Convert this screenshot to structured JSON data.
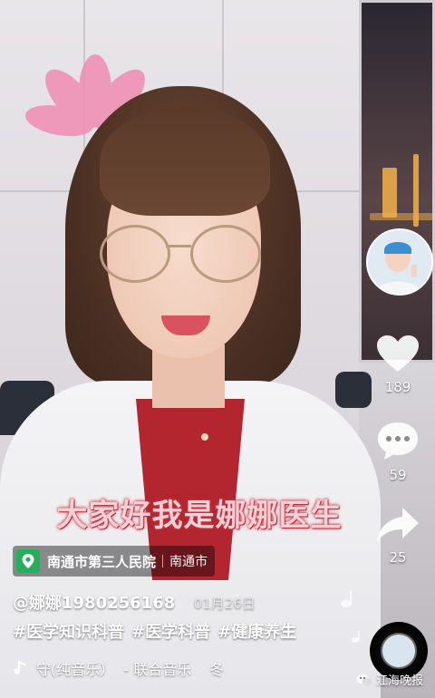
{
  "video": {
    "caption": "大家好我是娜娜医生"
  },
  "location": {
    "icon": "map-pin-icon",
    "name": "南通市第三人民院",
    "city": "南通市",
    "accent": "#23b05a"
  },
  "post": {
    "author": "@娜娜1980256168",
    "dot": "·",
    "date": "01月26日",
    "hashtags": [
      "#医学知识科普",
      "#医学科普",
      "#健康养生"
    ]
  },
  "music": {
    "icon": "music-note-icon",
    "title": "守(纯音乐）  - 联合音乐",
    "trailing": "冬"
  },
  "actions": {
    "likes": "189",
    "comments": "59",
    "shares": "25"
  },
  "watermark": {
    "text": "江海晚报"
  },
  "colors": {
    "caption_fill": "#f7cfd6",
    "caption_stroke": "#c9353f"
  }
}
